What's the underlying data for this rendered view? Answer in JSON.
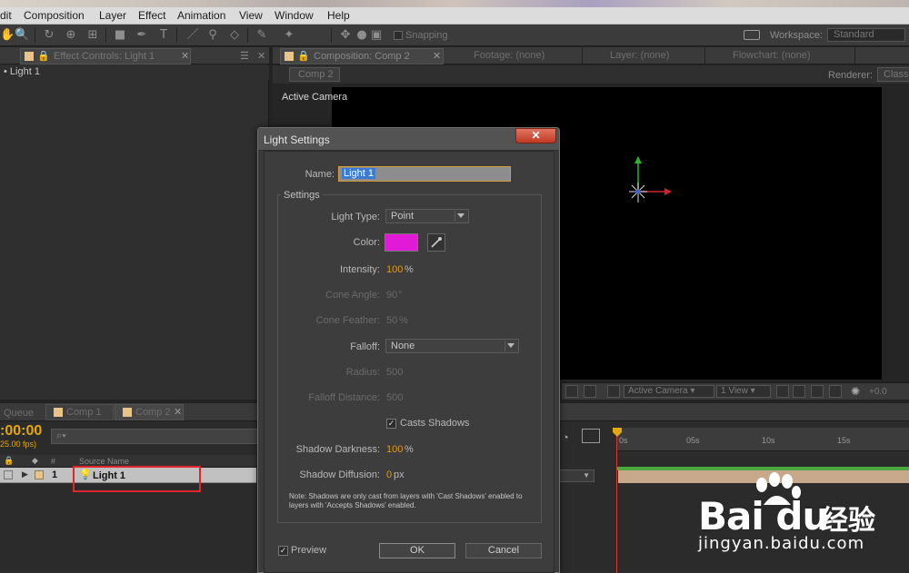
{
  "menu": [
    "dit",
    "Composition",
    "Layer",
    "Effect",
    "Animation",
    "View",
    "Window",
    "Help"
  ],
  "toolbar": {
    "snapping_label": "Snapping",
    "workspace_label": "Workspace:",
    "workspace_value": "Standard"
  },
  "left_panel": {
    "tab_label": "Effect Controls: Light 1",
    "sub_label": "• Light 1"
  },
  "comp_panel": {
    "tabs": [
      {
        "label": "Composition: Comp 2"
      },
      {
        "label": "Footage: (none)"
      },
      {
        "label": "Layer: (none)"
      },
      {
        "label": "Flowchart: (none)"
      }
    ],
    "comp_chip": "Comp 2",
    "renderer_label": "Renderer:",
    "renderer_value": "Classi",
    "active_camera_label": "Active Camera",
    "viewer_controls": {
      "view_select": "Active Camera",
      "view_count": "1 View",
      "exposure": "+0.0"
    }
  },
  "timeline": {
    "tabs": [
      "Queue",
      "Comp 1",
      "Comp 2"
    ],
    "timecode": ":00:00",
    "fps": "25.00 fps)",
    "search_placeholder": "⌕▾",
    "col_number": "#",
    "col_source": "Source Name",
    "layer_number": "1",
    "layer_name": "Light 1",
    "ruler": [
      "0s",
      "05s",
      "10s",
      "15s"
    ]
  },
  "dialog": {
    "title": "Light Settings",
    "close_glyph": "✕",
    "name_label": "Name:",
    "name_value": "Light 1",
    "settings_title": "Settings",
    "light_type_label": "Light Type:",
    "light_type_value": "Point",
    "color_label": "Color:",
    "color_value": "#e01ad6",
    "intensity_label": "Intensity:",
    "intensity_value": "100",
    "intensity_unit": "%",
    "cone_angle_label": "Cone Angle:",
    "cone_angle_value": "90",
    "cone_angle_unit": "°",
    "cone_feather_label": "Cone Feather:",
    "cone_feather_value": "50",
    "cone_feather_unit": "%",
    "falloff_label": "Falloff:",
    "falloff_value": "None",
    "radius_label": "Radius:",
    "radius_value": "500",
    "falloff_distance_label": "Falloff Distance:",
    "falloff_distance_value": "500",
    "casts_shadows_label": "Casts Shadows",
    "casts_shadows_checked": true,
    "shadow_darkness_label": "Shadow Darkness:",
    "shadow_darkness_value": "100",
    "shadow_darkness_unit": "%",
    "shadow_diffusion_label": "Shadow Diffusion:",
    "shadow_diffusion_value": "0",
    "shadow_diffusion_unit": "px",
    "note": "Note: Shadows are only cast from layers with 'Cast Shadows' enabled to layers with 'Accepts Shadows' enabled.",
    "preview_label": "Preview",
    "preview_checked": true,
    "ok_label": "OK",
    "cancel_label": "Cancel"
  },
  "watermark": {
    "brand": "Bai du",
    "cn": "经验",
    "url": "jingyan.baidu.com"
  },
  "colors": {
    "accent_orange": "#e3a80c",
    "highlight_red": "#e0252b",
    "swatch": "#e01ad6"
  }
}
